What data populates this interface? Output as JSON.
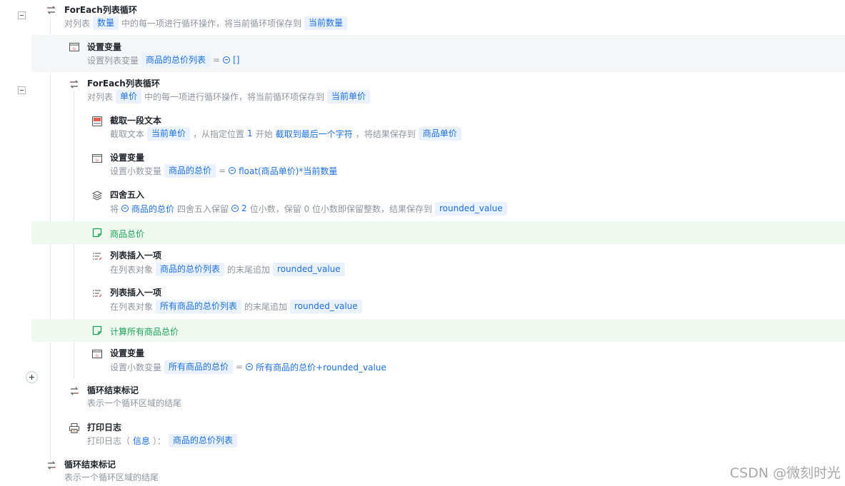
{
  "rows": {
    "r1": {
      "title": "ForEach列表循环",
      "icon": "loop-icon",
      "p1": "对列表",
      "t1": "数量",
      "p2": "中的每一项进行循环操作，将当前循环项保存到",
      "t2": "当前数量"
    },
    "r2": {
      "title": "设置变量",
      "icon": "variable-icon",
      "p1": "设置列表变量",
      "t1": "商品的总价列表",
      "eq": "=",
      "v1": "[]"
    },
    "r3": {
      "title": "ForEach列表循环",
      "icon": "loop-icon",
      "p1": "对列表",
      "t1": "单价",
      "p2": "中的每一项进行循环操作，将当前循环项保存到",
      "t2": "当前单价"
    },
    "r4": {
      "title": "截取一段文本",
      "icon": "text-substring-icon",
      "p1": "截取文本",
      "t1": "当前单价",
      "p2": "，从指定位置",
      "n1": "1",
      "p3": "开始",
      "b1": "截取到最后一个字符",
      "p4": "，将结果保存到",
      "t2": "商品单价"
    },
    "r5": {
      "title": "设置变量",
      "icon": "variable-icon",
      "p1": "设置小数变量",
      "t1": "商品的总价",
      "eq": "=",
      "v1": "float(商品单价)*当前数量"
    },
    "r6": {
      "title": "四舍五入",
      "icon": "layers-icon",
      "p1": "将",
      "v1": "商品的总价",
      "p2": "四舍五入保留",
      "v2": "2",
      "p3": "位小数，保留 0 位小数即保留整数，结果保存到",
      "t1": "rounded_value"
    },
    "r7": {
      "note": "商品总价",
      "icon": "note-icon"
    },
    "r8": {
      "title": "列表插入一项",
      "icon": "list-insert-icon",
      "p1": "在列表对象",
      "t1": "商品的总价列表",
      "p2": "的末尾追加",
      "t2": "rounded_value"
    },
    "r9": {
      "title": "列表插入一项",
      "icon": "list-insert-icon",
      "p1": "在列表对象",
      "t1": "所有商品的总价列表",
      "p2": "的末尾追加",
      "t2": "rounded_value"
    },
    "r10": {
      "note": "计算所有商品总价",
      "icon": "note-icon"
    },
    "r11": {
      "title": "设置变量",
      "icon": "variable-icon",
      "p1": "设置小数变量",
      "t1": "所有商品的总价",
      "eq": "=",
      "v1": "所有商品的总价+rounded_value"
    },
    "r12": {
      "title": "循环结束标记",
      "icon": "loop-end-icon",
      "p1": "表示一个循环区域的结尾"
    },
    "r13": {
      "title": "打印日志",
      "icon": "printer-icon",
      "p1": "打印日志（",
      "b1": "信息",
      "p2": "）：",
      "t1": "商品的总价列表"
    },
    "r14": {
      "title": "循环结束标记",
      "icon": "loop-end-icon",
      "p1": "表示一个循环区域的结尾"
    }
  },
  "watermark": "CSDN @微刻时光",
  "colors": {
    "accent": "#1d6fe0",
    "tag_bg": "#eaf2ff",
    "note_green": "#18a058",
    "note_bg": "#f0f9f0",
    "highlight_bg": "#f5f6f8"
  }
}
